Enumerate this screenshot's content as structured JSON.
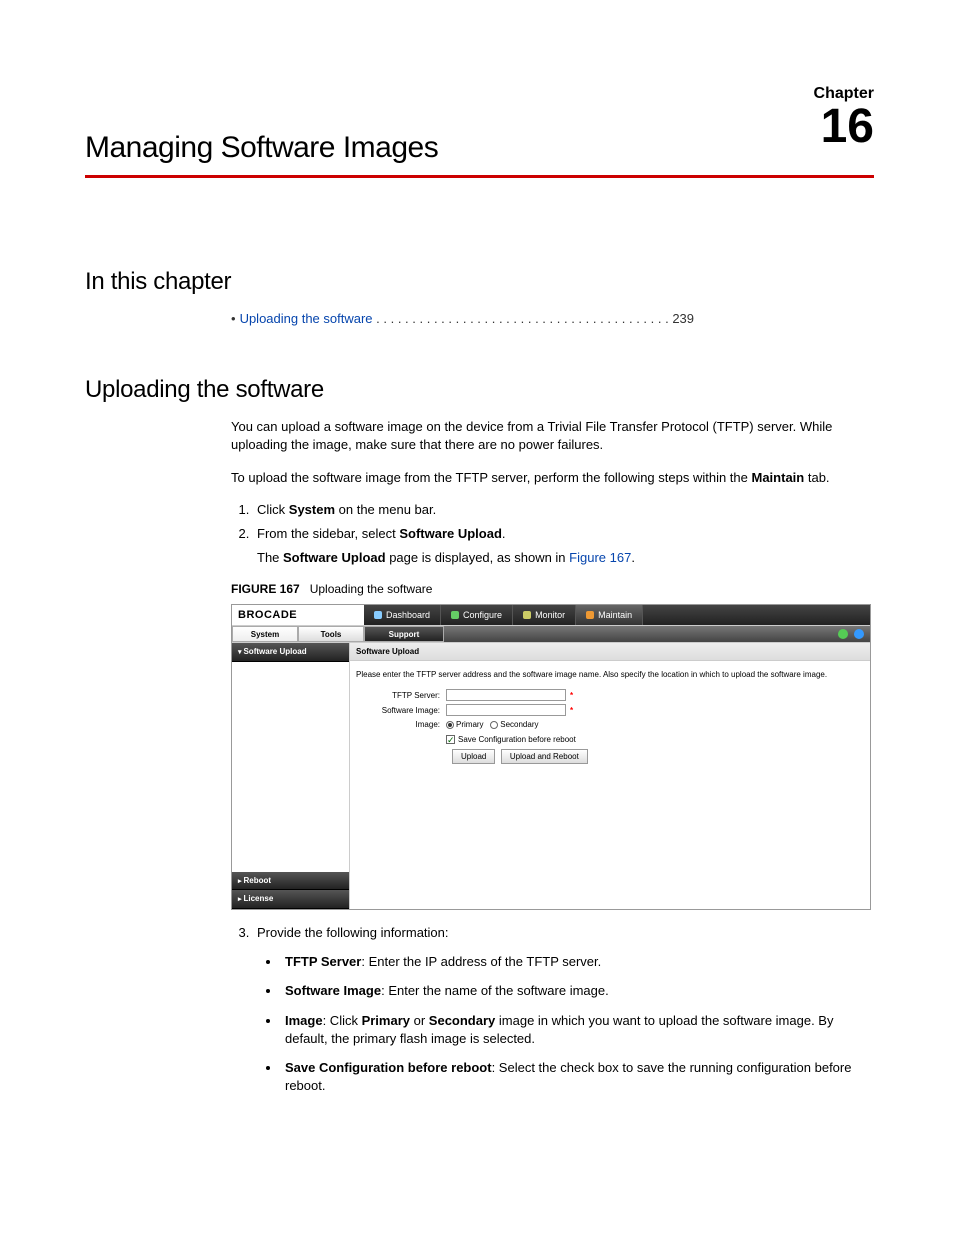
{
  "header": {
    "chapter_label": "Chapter",
    "chapter_number": "16",
    "title": "Managing Software Images"
  },
  "sections": {
    "in_this_chapter": "In this chapter",
    "uploading": "Uploading the software"
  },
  "toc": {
    "bullet": "•",
    "item": "Uploading the software",
    "dots": " . . . . . . . . . . . . . . . . . . . . . . . . . . . . . . . . . . . . . . . . .  ",
    "page": "239"
  },
  "content": {
    "intro1": "You can upload a software image on the device from a Trivial File Transfer Protocol (TFTP) server. While uploading the image, make sure that there are no power failures.",
    "intro2_a": "To upload the software image from the TFTP server, perform the following steps within the ",
    "intro2_b": "Maintain",
    "intro2_c": " tab.",
    "step1_a": "Click ",
    "step1_b": "System",
    "step1_c": " on the menu bar.",
    "step2_a": "From the sidebar, select ",
    "step2_b": "Software Upload",
    "step2_c": ".",
    "step2_sub_a": "The ",
    "step2_sub_b": "Software Upload",
    "step2_sub_c": " page is displayed, as shown in ",
    "step2_sub_link": "Figure 167",
    "step2_sub_d": ".",
    "fig_caption_id": "FIGURE 167",
    "fig_caption_title": "Uploading the software",
    "step3": "Provide the following information:",
    "b1_a": "TFTP Server",
    "b1_b": ": Enter the IP address of the TFTP server.",
    "b2_a": "Software Image",
    "b2_b": ": Enter the name of the software image.",
    "b3_a": "Image",
    "b3_b": ": Click ",
    "b3_c": "Primary",
    "b3_d": " or ",
    "b3_e": "Secondary",
    "b3_f": " image in which you want to upload the software image. By default, the primary flash image is selected.",
    "b4_a": "Save Configuration before reboot",
    "b4_b": ": Select the check box to save the running configuration before reboot."
  },
  "figure": {
    "brand": "BROCADE",
    "nav": {
      "dashboard": "Dashboard",
      "configure": "Configure",
      "monitor": "Monitor",
      "maintain": "Maintain"
    },
    "subtabs": {
      "system": "System",
      "tools": "Tools",
      "support": "Support"
    },
    "sidebar": {
      "swupload": "Software Upload",
      "reboot": "Reboot",
      "license": "License"
    },
    "pane_title": "Software Upload",
    "instruction": "Please enter the TFTP server address and the software image name. Also specify the location in which to upload the software image.",
    "labels": {
      "tftp": "TFTP Server:",
      "swimage": "Software Image:",
      "image": "Image:"
    },
    "radios": {
      "primary": "Primary",
      "secondary": "Secondary"
    },
    "checkbox": "Save Configuration before reboot",
    "buttons": {
      "upload": "Upload",
      "upload_reboot": "Upload and Reboot"
    },
    "req": "*"
  }
}
